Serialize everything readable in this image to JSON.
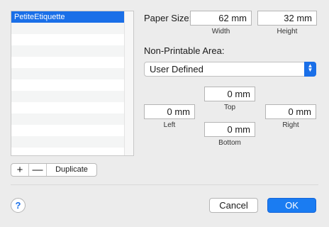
{
  "list": {
    "items": [
      "PetiteEtiquette"
    ],
    "selected_index": 0
  },
  "list_controls": {
    "add_label": "+",
    "remove_label": "—",
    "duplicate_label": "Duplicate"
  },
  "paper_size": {
    "label": "Paper Size:",
    "width_value": "62 mm",
    "width_caption": "Width",
    "height_value": "32 mm",
    "height_caption": "Height"
  },
  "non_printable": {
    "label": "Non-Printable Area:",
    "popup_value": "User Defined",
    "top_value": "0 mm",
    "top_caption": "Top",
    "left_value": "0 mm",
    "left_caption": "Left",
    "right_value": "0 mm",
    "right_caption": "Right",
    "bottom_value": "0 mm",
    "bottom_caption": "Bottom"
  },
  "footer": {
    "help_label": "?",
    "cancel_label": "Cancel",
    "ok_label": "OK"
  },
  "colors": {
    "accent": "#1a6fe8",
    "window_bg": "#ececec"
  }
}
